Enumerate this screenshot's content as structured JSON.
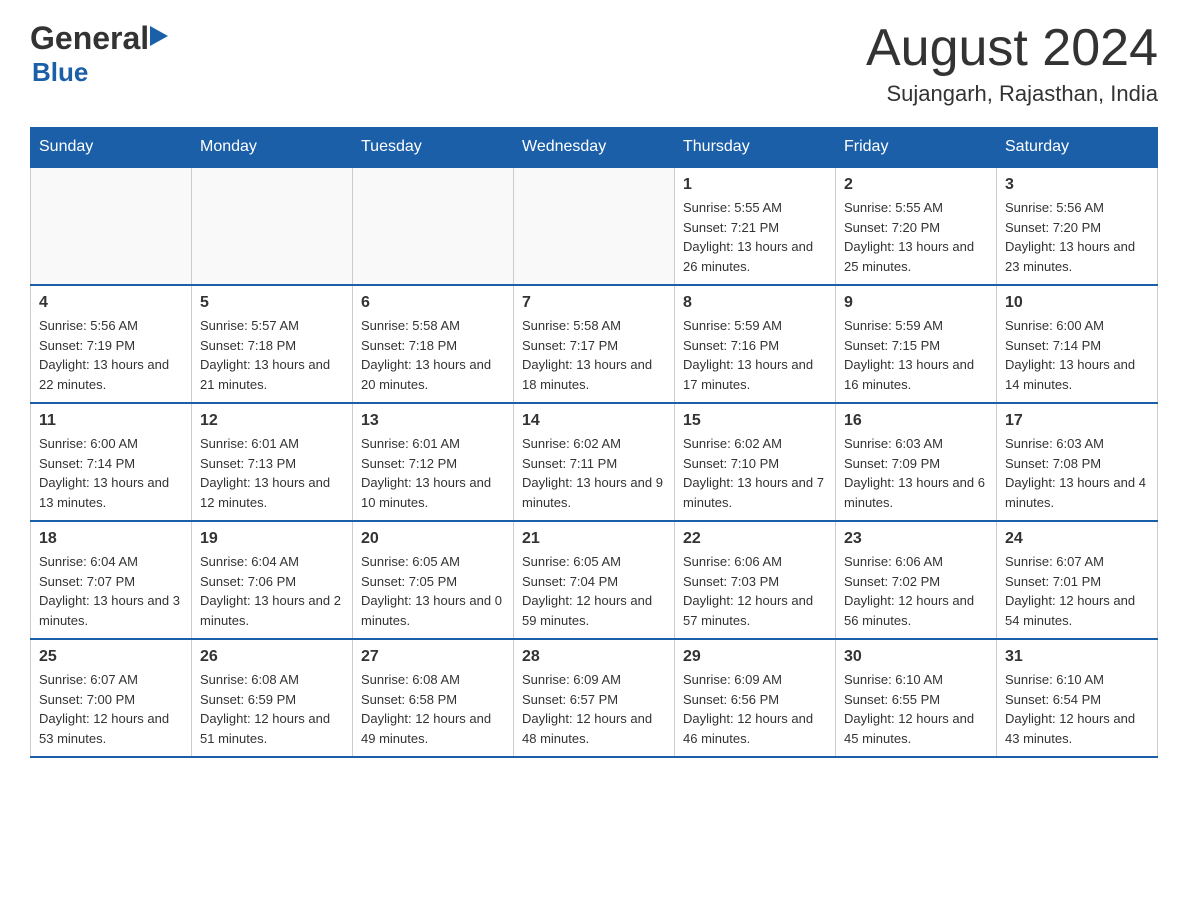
{
  "header": {
    "logo_general": "General",
    "logo_blue": "Blue",
    "month_year": "August 2024",
    "location": "Sujangarh, Rajasthan, India"
  },
  "days_of_week": [
    "Sunday",
    "Monday",
    "Tuesday",
    "Wednesday",
    "Thursday",
    "Friday",
    "Saturday"
  ],
  "weeks": [
    [
      {
        "day": "",
        "info": ""
      },
      {
        "day": "",
        "info": ""
      },
      {
        "day": "",
        "info": ""
      },
      {
        "day": "",
        "info": ""
      },
      {
        "day": "1",
        "info": "Sunrise: 5:55 AM\nSunset: 7:21 PM\nDaylight: 13 hours and 26 minutes."
      },
      {
        "day": "2",
        "info": "Sunrise: 5:55 AM\nSunset: 7:20 PM\nDaylight: 13 hours and 25 minutes."
      },
      {
        "day": "3",
        "info": "Sunrise: 5:56 AM\nSunset: 7:20 PM\nDaylight: 13 hours and 23 minutes."
      }
    ],
    [
      {
        "day": "4",
        "info": "Sunrise: 5:56 AM\nSunset: 7:19 PM\nDaylight: 13 hours and 22 minutes."
      },
      {
        "day": "5",
        "info": "Sunrise: 5:57 AM\nSunset: 7:18 PM\nDaylight: 13 hours and 21 minutes."
      },
      {
        "day": "6",
        "info": "Sunrise: 5:58 AM\nSunset: 7:18 PM\nDaylight: 13 hours and 20 minutes."
      },
      {
        "day": "7",
        "info": "Sunrise: 5:58 AM\nSunset: 7:17 PM\nDaylight: 13 hours and 18 minutes."
      },
      {
        "day": "8",
        "info": "Sunrise: 5:59 AM\nSunset: 7:16 PM\nDaylight: 13 hours and 17 minutes."
      },
      {
        "day": "9",
        "info": "Sunrise: 5:59 AM\nSunset: 7:15 PM\nDaylight: 13 hours and 16 minutes."
      },
      {
        "day": "10",
        "info": "Sunrise: 6:00 AM\nSunset: 7:14 PM\nDaylight: 13 hours and 14 minutes."
      }
    ],
    [
      {
        "day": "11",
        "info": "Sunrise: 6:00 AM\nSunset: 7:14 PM\nDaylight: 13 hours and 13 minutes."
      },
      {
        "day": "12",
        "info": "Sunrise: 6:01 AM\nSunset: 7:13 PM\nDaylight: 13 hours and 12 minutes."
      },
      {
        "day": "13",
        "info": "Sunrise: 6:01 AM\nSunset: 7:12 PM\nDaylight: 13 hours and 10 minutes."
      },
      {
        "day": "14",
        "info": "Sunrise: 6:02 AM\nSunset: 7:11 PM\nDaylight: 13 hours and 9 minutes."
      },
      {
        "day": "15",
        "info": "Sunrise: 6:02 AM\nSunset: 7:10 PM\nDaylight: 13 hours and 7 minutes."
      },
      {
        "day": "16",
        "info": "Sunrise: 6:03 AM\nSunset: 7:09 PM\nDaylight: 13 hours and 6 minutes."
      },
      {
        "day": "17",
        "info": "Sunrise: 6:03 AM\nSunset: 7:08 PM\nDaylight: 13 hours and 4 minutes."
      }
    ],
    [
      {
        "day": "18",
        "info": "Sunrise: 6:04 AM\nSunset: 7:07 PM\nDaylight: 13 hours and 3 minutes."
      },
      {
        "day": "19",
        "info": "Sunrise: 6:04 AM\nSunset: 7:06 PM\nDaylight: 13 hours and 2 minutes."
      },
      {
        "day": "20",
        "info": "Sunrise: 6:05 AM\nSunset: 7:05 PM\nDaylight: 13 hours and 0 minutes."
      },
      {
        "day": "21",
        "info": "Sunrise: 6:05 AM\nSunset: 7:04 PM\nDaylight: 12 hours and 59 minutes."
      },
      {
        "day": "22",
        "info": "Sunrise: 6:06 AM\nSunset: 7:03 PM\nDaylight: 12 hours and 57 minutes."
      },
      {
        "day": "23",
        "info": "Sunrise: 6:06 AM\nSunset: 7:02 PM\nDaylight: 12 hours and 56 minutes."
      },
      {
        "day": "24",
        "info": "Sunrise: 6:07 AM\nSunset: 7:01 PM\nDaylight: 12 hours and 54 minutes."
      }
    ],
    [
      {
        "day": "25",
        "info": "Sunrise: 6:07 AM\nSunset: 7:00 PM\nDaylight: 12 hours and 53 minutes."
      },
      {
        "day": "26",
        "info": "Sunrise: 6:08 AM\nSunset: 6:59 PM\nDaylight: 12 hours and 51 minutes."
      },
      {
        "day": "27",
        "info": "Sunrise: 6:08 AM\nSunset: 6:58 PM\nDaylight: 12 hours and 49 minutes."
      },
      {
        "day": "28",
        "info": "Sunrise: 6:09 AM\nSunset: 6:57 PM\nDaylight: 12 hours and 48 minutes."
      },
      {
        "day": "29",
        "info": "Sunrise: 6:09 AM\nSunset: 6:56 PM\nDaylight: 12 hours and 46 minutes."
      },
      {
        "day": "30",
        "info": "Sunrise: 6:10 AM\nSunset: 6:55 PM\nDaylight: 12 hours and 45 minutes."
      },
      {
        "day": "31",
        "info": "Sunrise: 6:10 AM\nSunset: 6:54 PM\nDaylight: 12 hours and 43 minutes."
      }
    ]
  ]
}
